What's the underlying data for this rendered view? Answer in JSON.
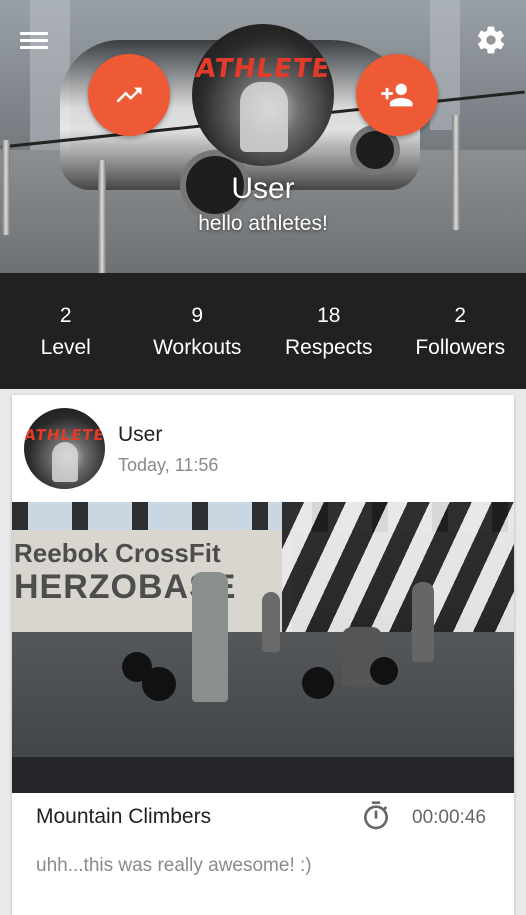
{
  "header": {
    "menu_icon": "hamburger-menu-icon",
    "settings_icon": "gear-icon",
    "progress_icon": "trending-up-icon",
    "add_friend_icon": "person-add-icon",
    "avatar_logo_text": "ATHLETE",
    "user_name": "User",
    "status": "hello athletes!",
    "accent_color": "#ee5a36"
  },
  "stats": [
    {
      "value": "2",
      "label": "Level"
    },
    {
      "value": "9",
      "label": "Workouts"
    },
    {
      "value": "18",
      "label": "Respects"
    },
    {
      "value": "2",
      "label": "Followers"
    }
  ],
  "post": {
    "avatar_logo_text": "ATHLETE",
    "user": "User",
    "time": "Today, 11:56",
    "photo_sign_line1": "Reebok CrossFit",
    "photo_sign_line2": "HERZOBASE",
    "exercise": "Mountain Climbers",
    "timer_icon": "stopwatch-icon",
    "duration": "00:00:46",
    "comment": "uhh...this was really awesome! :)"
  }
}
